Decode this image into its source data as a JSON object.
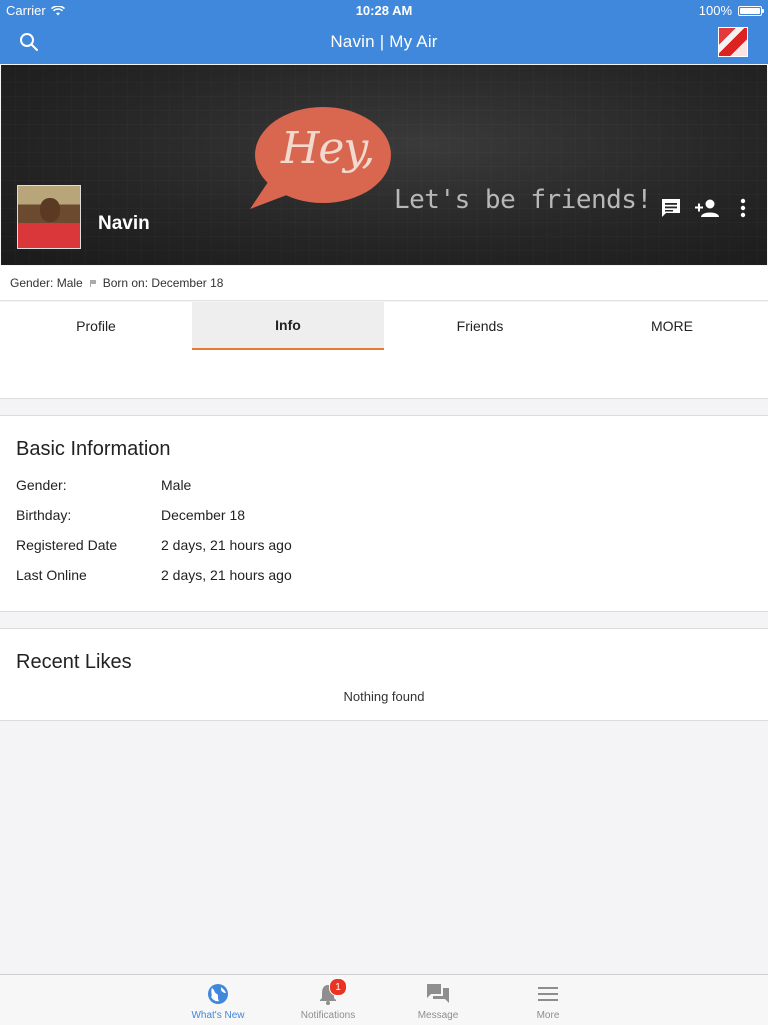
{
  "status_bar": {
    "carrier": "Carrier",
    "time": "10:28 AM",
    "battery": "100%",
    "battery_level": 1.0
  },
  "nav": {
    "title": "Navin | My Air"
  },
  "cover": {
    "hey_text": "Hey,",
    "friends_text": "Let's be friends!",
    "profile_name": "Navin"
  },
  "meta": {
    "gender": "Gender: Male",
    "born": "Born on: December 18"
  },
  "tabs": [
    {
      "label": "Profile",
      "active": false
    },
    {
      "label": "Info",
      "active": true
    },
    {
      "label": "Friends",
      "active": false
    },
    {
      "label": "MORE",
      "active": false
    }
  ],
  "basic_info": {
    "title": "Basic Information",
    "rows": [
      {
        "label": "Gender:",
        "value": "Male"
      },
      {
        "label": "Birthday:",
        "value": "December 18"
      },
      {
        "label": "Registered Date",
        "value": "2 days, 21 hours ago"
      },
      {
        "label": "Last Online",
        "value": "2 days, 21 hours ago"
      }
    ]
  },
  "recent_likes": {
    "title": "Recent Likes",
    "empty_text": "Nothing found"
  },
  "tabbar": {
    "items": [
      {
        "label": "What's New",
        "icon": "globe-icon",
        "active": true
      },
      {
        "label": "Notifications",
        "icon": "bell-icon",
        "badge": "1"
      },
      {
        "label": "Message",
        "icon": "chat-icon"
      },
      {
        "label": "More",
        "icon": "menu-icon"
      }
    ]
  },
  "colors": {
    "accent": "#3f88dc",
    "tab_indicator": "#e87a32",
    "bubble": "#d9664f",
    "badge": "#ea3323"
  }
}
